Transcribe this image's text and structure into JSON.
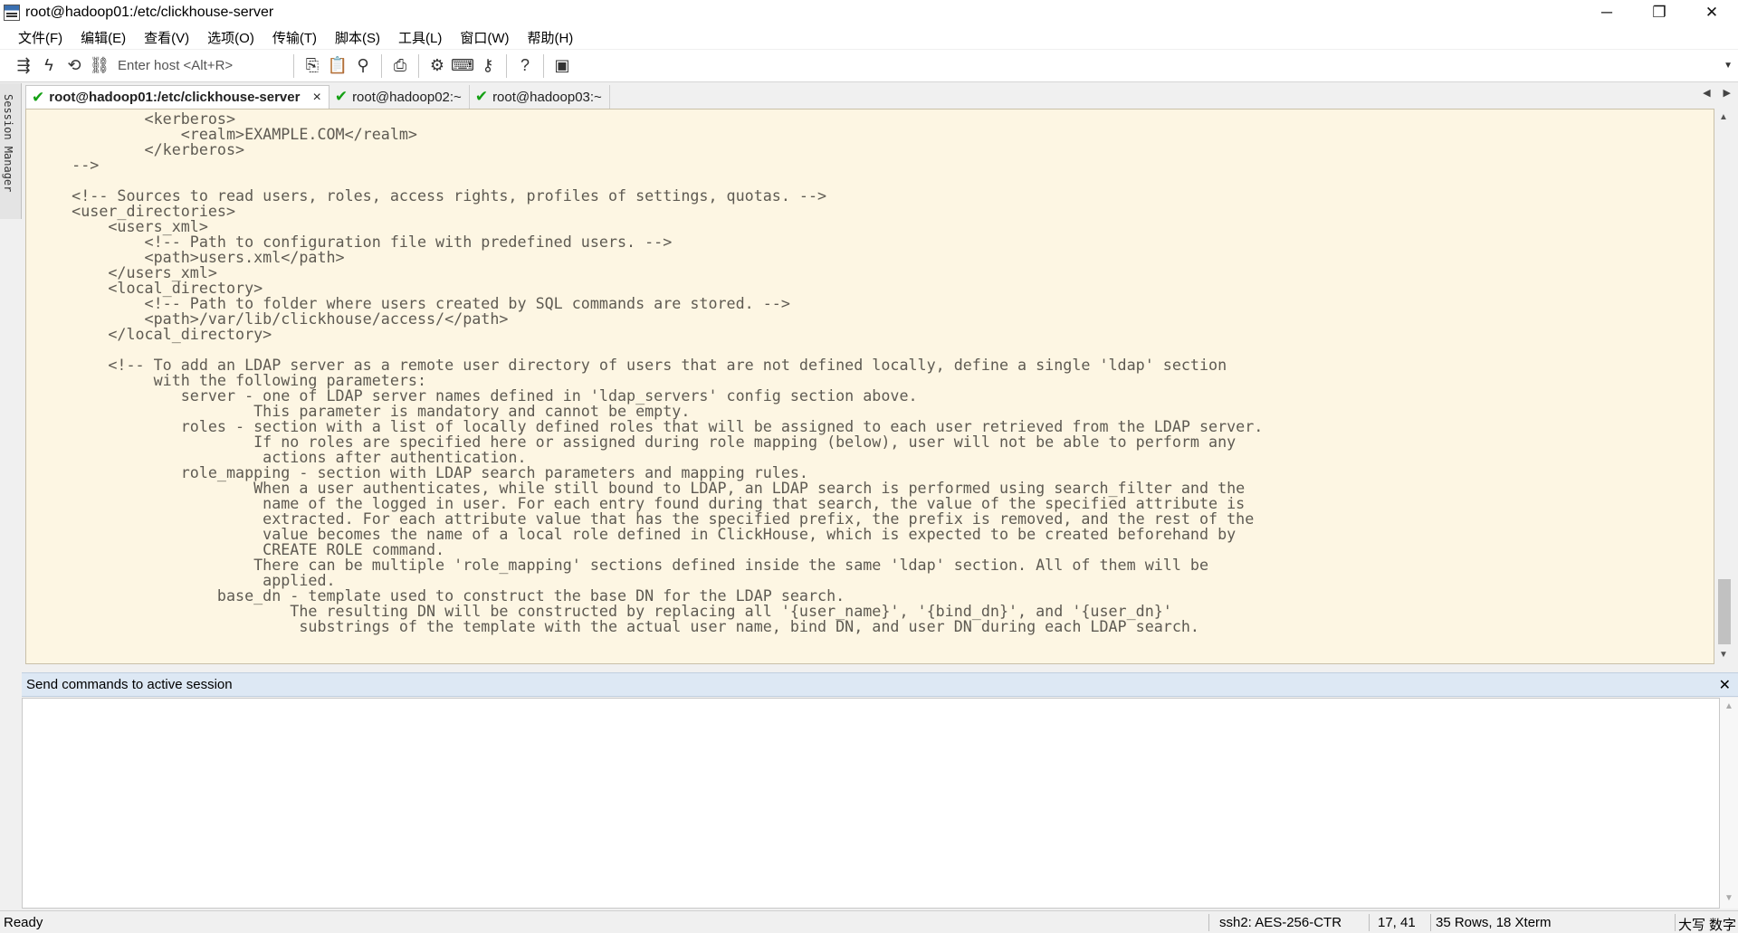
{
  "window": {
    "title": "root@hadoop01:/etc/clickhouse-server",
    "controls": [
      "─",
      "❐",
      "✕"
    ]
  },
  "menu": [
    "文件(F)",
    "编辑(E)",
    "查看(V)",
    "选项(O)",
    "传输(T)",
    "脚本(S)",
    "工具(L)",
    "窗口(W)",
    "帮助(H)"
  ],
  "toolbar": {
    "host_placeholder": "Enter host <Alt+R>",
    "icons": [
      "connect-icon",
      "quick-connect-icon",
      "reconnect-icon",
      "disconnect-icon",
      "copy-icon",
      "paste-icon",
      "find-icon",
      "print-icon",
      "settings-icon",
      "keymap-icon",
      "sftp-icon",
      "help-icon",
      "screen-icon"
    ]
  },
  "session_manager": {
    "label": "Session Manager"
  },
  "tabs": [
    {
      "label": "root@hadoop01:/etc/clickhouse-server",
      "active": true,
      "close": "×"
    },
    {
      "label": "root@hadoop02:~",
      "active": false
    },
    {
      "label": "root@hadoop03:~",
      "active": false
    }
  ],
  "terminal": {
    "lines": [
      "            <kerberos>",
      "                <realm>EXAMPLE.COM</realm>",
      "            </kerberos>",
      "    -->",
      "",
      "    <!-- Sources to read users, roles, access rights, profiles of settings, quotas. -->",
      "    <user_directories>",
      "        <users_xml>",
      "            <!-- Path to configuration file with predefined users. -->",
      "            <path>users.xml</path>",
      "        </users_xml>",
      "        <local_directory>",
      "            <!-- Path to folder where users created by SQL commands are stored. -->",
      "            <path>/var/lib/clickhouse/access/</path>",
      "        </local_directory>",
      "",
      "        <!-- To add an LDAP server as a remote user directory of users that are not defined locally, define a single 'ldap' section",
      "             with the following parameters:",
      "                server - one of LDAP server names defined in 'ldap_servers' config section above.",
      "                        This parameter is mandatory and cannot be empty.",
      "                roles - section with a list of locally defined roles that will be assigned to each user retrieved from the LDAP server.",
      "                        If no roles are specified here or assigned during role mapping (below), user will not be able to perform any",
      "                         actions after authentication.",
      "                role_mapping - section with LDAP search parameters and mapping rules.",
      "                        When a user authenticates, while still bound to LDAP, an LDAP search is performed using search_filter and the",
      "                         name of the logged in user. For each entry found during that search, the value of the specified attribute is",
      "                         extracted. For each attribute value that has the specified prefix, the prefix is removed, and the rest of the",
      "                         value becomes the name of a local role defined in ClickHouse, which is expected to be created beforehand by",
      "                         CREATE ROLE command.",
      "                        There can be multiple 'role_mapping' sections defined inside the same 'ldap' section. All of them will be",
      "                         applied.",
      "                    base_dn - template used to construct the base DN for the LDAP search.",
      "                            The resulting DN will be constructed by replacing all '{user_name}', '{bind_dn}', and '{user_dn}'",
      "                             substrings of the template with the actual user name, bind DN, and user DN during each LDAP search."
    ],
    "background": "#fdf6e3",
    "foreground": "#5e5a52"
  },
  "send_commands": {
    "header": "Send commands to active session",
    "close": "✕",
    "value": ""
  },
  "status": {
    "ready": "Ready",
    "cipher": "ssh2: AES-256-CTR",
    "cursor": "17, 41",
    "size": "35 Rows, 18 Xterm",
    "caps": "大写",
    "num": "数字"
  }
}
